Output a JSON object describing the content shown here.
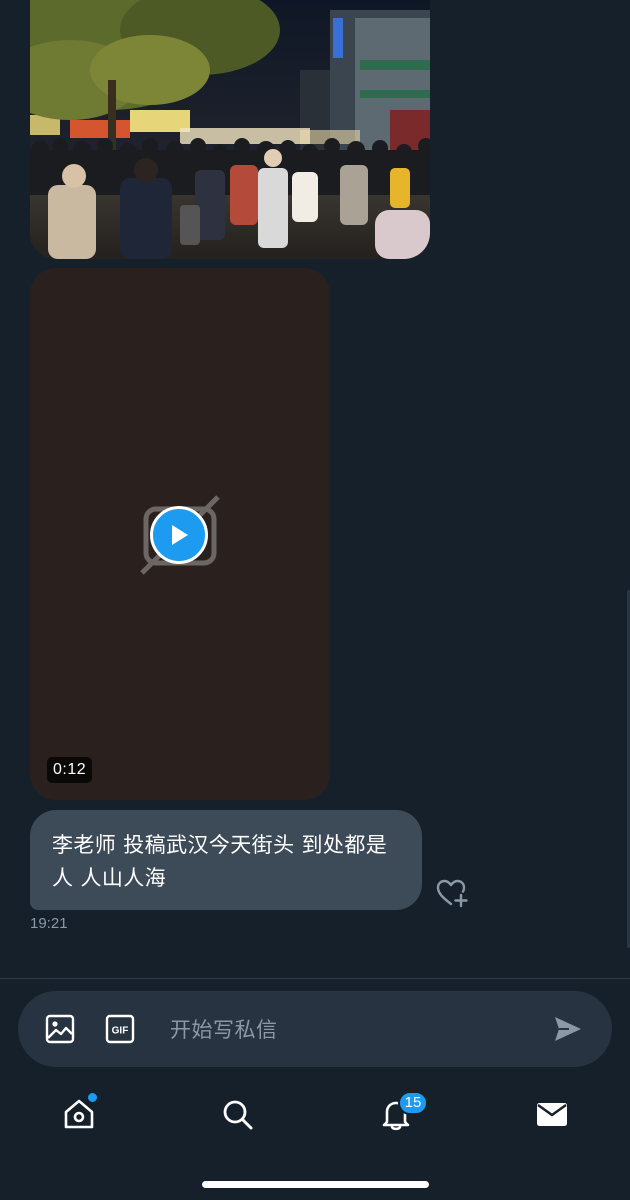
{
  "conversation": {
    "messages": [
      {
        "type": "image"
      },
      {
        "type": "video",
        "duration": "0:12"
      },
      {
        "type": "text",
        "text": "李老师  投稿武汉今天街头 到处都是人 人山人海",
        "time": "19:21"
      }
    ]
  },
  "composer": {
    "placeholder": "开始写私信"
  },
  "tab_bar": {
    "tabs": [
      {
        "name": "home",
        "icon": "home-icon",
        "has_dot": true
      },
      {
        "name": "search",
        "icon": "search-icon"
      },
      {
        "name": "notifications",
        "icon": "bell-icon",
        "badge": "15"
      },
      {
        "name": "messages",
        "icon": "mail-icon"
      }
    ]
  },
  "colors": {
    "background": "#15202b",
    "bubble": "#3d4a57",
    "composer": "#273340",
    "accent": "#1d9bf0",
    "muted_text": "#8b98a5"
  }
}
